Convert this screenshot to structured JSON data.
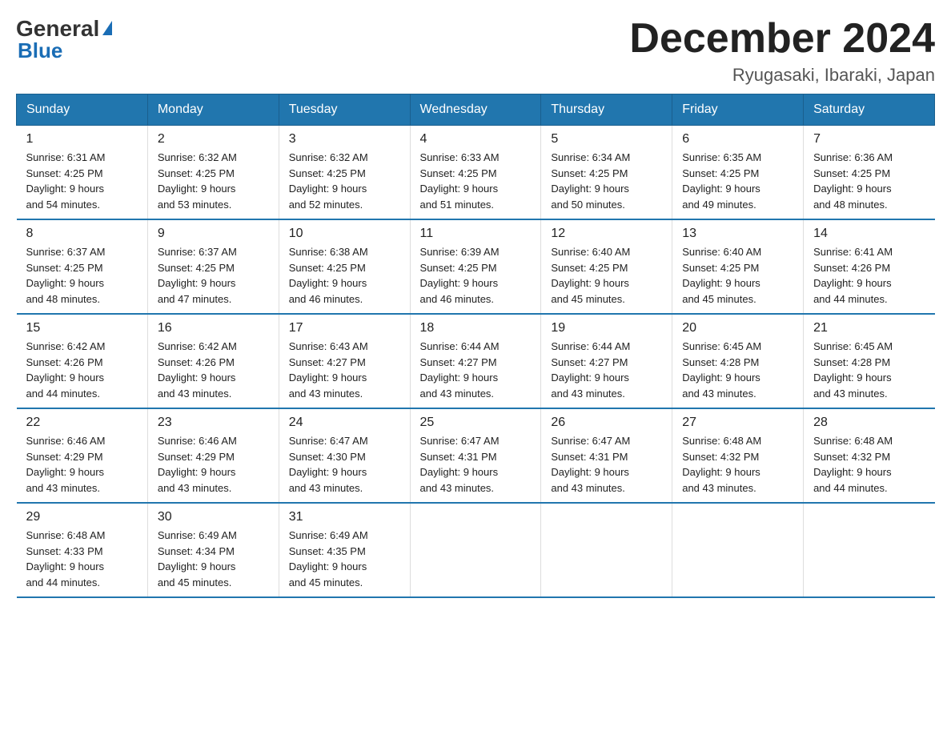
{
  "logo": {
    "general": "General",
    "blue": "Blue",
    "arrow": "▶"
  },
  "title": {
    "month_year": "December 2024",
    "location": "Ryugasaki, Ibaraki, Japan"
  },
  "weekdays": [
    "Sunday",
    "Monday",
    "Tuesday",
    "Wednesday",
    "Thursday",
    "Friday",
    "Saturday"
  ],
  "weeks": [
    [
      {
        "day": "1",
        "sunrise": "6:31 AM",
        "sunset": "4:25 PM",
        "daylight": "9 hours and 54 minutes."
      },
      {
        "day": "2",
        "sunrise": "6:32 AM",
        "sunset": "4:25 PM",
        "daylight": "9 hours and 53 minutes."
      },
      {
        "day": "3",
        "sunrise": "6:32 AM",
        "sunset": "4:25 PM",
        "daylight": "9 hours and 52 minutes."
      },
      {
        "day": "4",
        "sunrise": "6:33 AM",
        "sunset": "4:25 PM",
        "daylight": "9 hours and 51 minutes."
      },
      {
        "day": "5",
        "sunrise": "6:34 AM",
        "sunset": "4:25 PM",
        "daylight": "9 hours and 50 minutes."
      },
      {
        "day": "6",
        "sunrise": "6:35 AM",
        "sunset": "4:25 PM",
        "daylight": "9 hours and 49 minutes."
      },
      {
        "day": "7",
        "sunrise": "6:36 AM",
        "sunset": "4:25 PM",
        "daylight": "9 hours and 48 minutes."
      }
    ],
    [
      {
        "day": "8",
        "sunrise": "6:37 AM",
        "sunset": "4:25 PM",
        "daylight": "9 hours and 48 minutes."
      },
      {
        "day": "9",
        "sunrise": "6:37 AM",
        "sunset": "4:25 PM",
        "daylight": "9 hours and 47 minutes."
      },
      {
        "day": "10",
        "sunrise": "6:38 AM",
        "sunset": "4:25 PM",
        "daylight": "9 hours and 46 minutes."
      },
      {
        "day": "11",
        "sunrise": "6:39 AM",
        "sunset": "4:25 PM",
        "daylight": "9 hours and 46 minutes."
      },
      {
        "day": "12",
        "sunrise": "6:40 AM",
        "sunset": "4:25 PM",
        "daylight": "9 hours and 45 minutes."
      },
      {
        "day": "13",
        "sunrise": "6:40 AM",
        "sunset": "4:25 PM",
        "daylight": "9 hours and 45 minutes."
      },
      {
        "day": "14",
        "sunrise": "6:41 AM",
        "sunset": "4:26 PM",
        "daylight": "9 hours and 44 minutes."
      }
    ],
    [
      {
        "day": "15",
        "sunrise": "6:42 AM",
        "sunset": "4:26 PM",
        "daylight": "9 hours and 44 minutes."
      },
      {
        "day": "16",
        "sunrise": "6:42 AM",
        "sunset": "4:26 PM",
        "daylight": "9 hours and 43 minutes."
      },
      {
        "day": "17",
        "sunrise": "6:43 AM",
        "sunset": "4:27 PM",
        "daylight": "9 hours and 43 minutes."
      },
      {
        "day": "18",
        "sunrise": "6:44 AM",
        "sunset": "4:27 PM",
        "daylight": "9 hours and 43 minutes."
      },
      {
        "day": "19",
        "sunrise": "6:44 AM",
        "sunset": "4:27 PM",
        "daylight": "9 hours and 43 minutes."
      },
      {
        "day": "20",
        "sunrise": "6:45 AM",
        "sunset": "4:28 PM",
        "daylight": "9 hours and 43 minutes."
      },
      {
        "day": "21",
        "sunrise": "6:45 AM",
        "sunset": "4:28 PM",
        "daylight": "9 hours and 43 minutes."
      }
    ],
    [
      {
        "day": "22",
        "sunrise": "6:46 AM",
        "sunset": "4:29 PM",
        "daylight": "9 hours and 43 minutes."
      },
      {
        "day": "23",
        "sunrise": "6:46 AM",
        "sunset": "4:29 PM",
        "daylight": "9 hours and 43 minutes."
      },
      {
        "day": "24",
        "sunrise": "6:47 AM",
        "sunset": "4:30 PM",
        "daylight": "9 hours and 43 minutes."
      },
      {
        "day": "25",
        "sunrise": "6:47 AM",
        "sunset": "4:31 PM",
        "daylight": "9 hours and 43 minutes."
      },
      {
        "day": "26",
        "sunrise": "6:47 AM",
        "sunset": "4:31 PM",
        "daylight": "9 hours and 43 minutes."
      },
      {
        "day": "27",
        "sunrise": "6:48 AM",
        "sunset": "4:32 PM",
        "daylight": "9 hours and 43 minutes."
      },
      {
        "day": "28",
        "sunrise": "6:48 AM",
        "sunset": "4:32 PM",
        "daylight": "9 hours and 44 minutes."
      }
    ],
    [
      {
        "day": "29",
        "sunrise": "6:48 AM",
        "sunset": "4:33 PM",
        "daylight": "9 hours and 44 minutes."
      },
      {
        "day": "30",
        "sunrise": "6:49 AM",
        "sunset": "4:34 PM",
        "daylight": "9 hours and 45 minutes."
      },
      {
        "day": "31",
        "sunrise": "6:49 AM",
        "sunset": "4:35 PM",
        "daylight": "9 hours and 45 minutes."
      },
      {
        "day": "",
        "sunrise": "",
        "sunset": "",
        "daylight": ""
      },
      {
        "day": "",
        "sunrise": "",
        "sunset": "",
        "daylight": ""
      },
      {
        "day": "",
        "sunrise": "",
        "sunset": "",
        "daylight": ""
      },
      {
        "day": "",
        "sunrise": "",
        "sunset": "",
        "daylight": ""
      }
    ]
  ],
  "labels": {
    "sunrise": "Sunrise:",
    "sunset": "Sunset:",
    "daylight": "Daylight:"
  }
}
